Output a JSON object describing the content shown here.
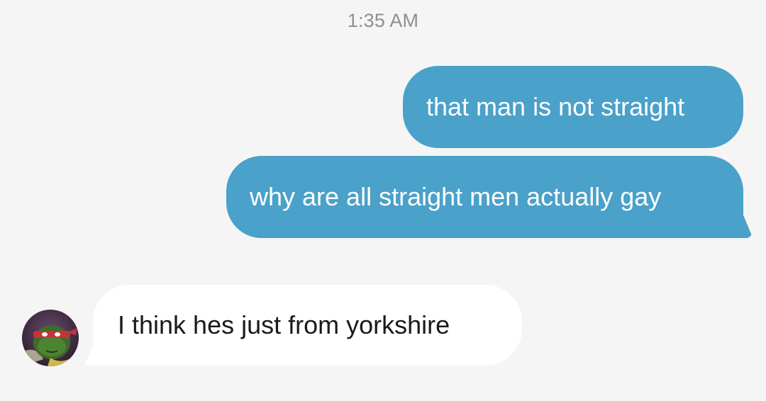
{
  "conversation": {
    "timestamp": "1:35 AM",
    "messages": [
      {
        "direction": "sent",
        "text": "that man is not straight"
      },
      {
        "direction": "sent",
        "text": "why are all straight men actually gay"
      },
      {
        "direction": "received",
        "text": "I think hes just from yorkshire"
      }
    ]
  },
  "colors": {
    "background": "#f5f5f5",
    "sent_bubble": "#4aa1c9",
    "received_bubble": "#ffffff",
    "timestamp": "#8e8e93"
  }
}
